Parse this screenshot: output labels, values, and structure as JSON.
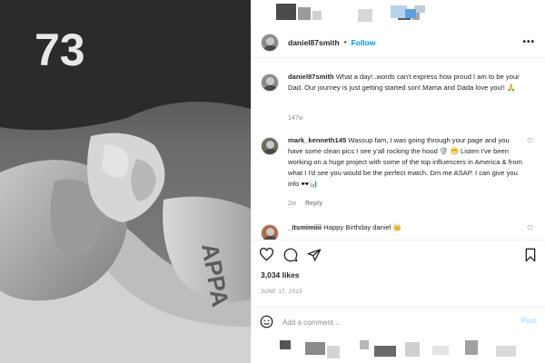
{
  "post": {
    "username": "daniel87smith",
    "separator": "•",
    "follow_label": "Follow",
    "more_label": "•••"
  },
  "photo": {
    "jersey_number": "73",
    "shirt_text": "APPA"
  },
  "comments": [
    {
      "username": "daniel87smith",
      "text": " What a day!..words can't express how proud I am to be your Dad. Our journey is just getting started son!.Mama and Dada love you!! 🙏",
      "time": "147w",
      "reply_label": ""
    },
    {
      "username": "mark_kenneth145",
      "text": " Wassup fam, I was going through your page and you have some clean pics I see y'all rocking the hood 🛡️ 😁 Listen I've been working on a huge project with some of the top influencers in America & from what I I'd see you would be the perfect match. Dm me ASAP. I can give you info 🕶️📊",
      "time": "2w",
      "reply_label": "Reply"
    },
    {
      "username": "_itsmimiiii",
      "text": " Happy Birthday daniel 👑",
      "time": "",
      "reply_label": ""
    }
  ],
  "stats": {
    "likes": "3,034 likes",
    "date": "JUNE 17, 2019"
  },
  "add_comment": {
    "placeholder": "Add a comment...",
    "post_label": "Post"
  },
  "icons": {
    "like": "heart-icon",
    "comment": "comment-bubble-icon",
    "share": "paper-plane-icon",
    "save": "bookmark-icon",
    "emoji": "smiley-icon"
  },
  "colors": {
    "link": "#0095f6",
    "muted": "#8e8e8e",
    "post_disabled": "#b2dffc",
    "border": "#efefef"
  }
}
